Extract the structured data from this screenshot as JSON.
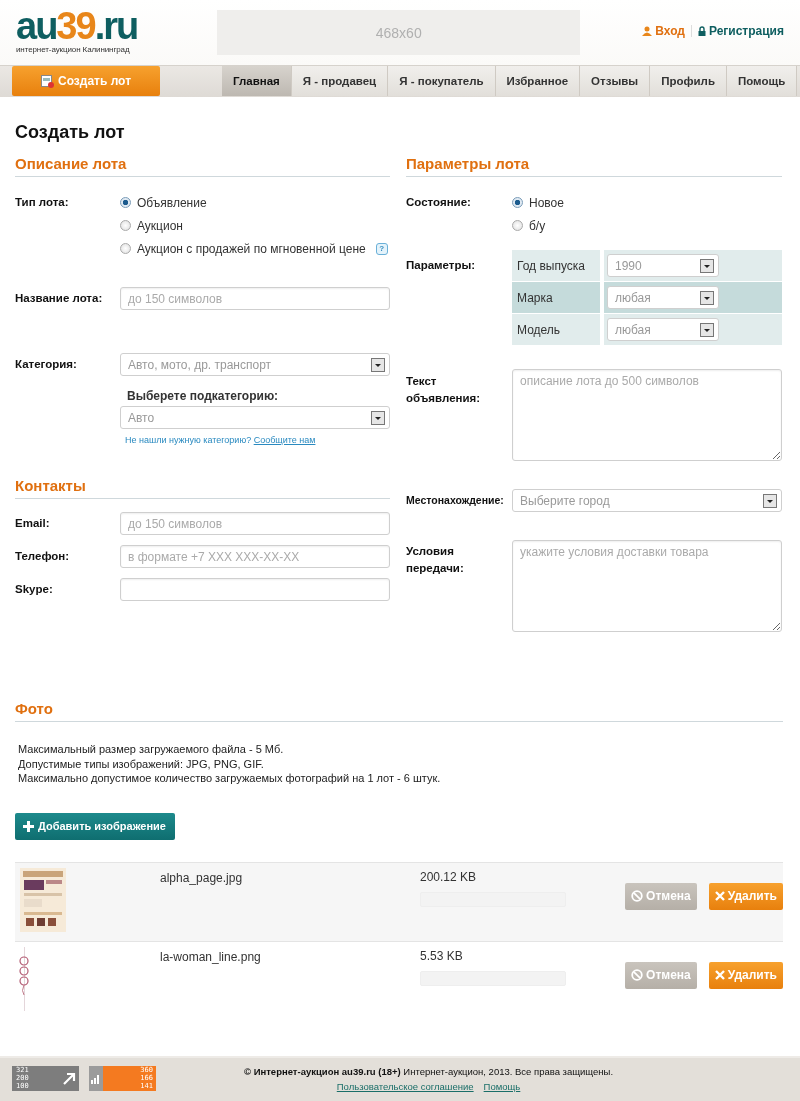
{
  "header": {
    "logo": [
      {
        "text": "au",
        "kind": "base"
      },
      {
        "text": "39",
        "kind": "accent"
      },
      {
        "text": ".ru",
        "kind": "base"
      }
    ],
    "tagline": "интернет-аукцион Калининград",
    "banner": "468x60",
    "login": "Вход",
    "register": "Регистрация"
  },
  "create_button": "Создать лот",
  "nav": [
    {
      "label": "Главная",
      "selected": true
    },
    {
      "label": "Я - продавец",
      "selected": false
    },
    {
      "label": "Я - покупатель",
      "selected": false
    },
    {
      "label": "Избранное",
      "selected": false
    },
    {
      "label": "Отзывы",
      "selected": false
    },
    {
      "label": "Профиль",
      "selected": false
    },
    {
      "label": "Помощь",
      "selected": false
    }
  ],
  "page_title": "Создать лот",
  "description": {
    "title": "Описание лота",
    "type_label": "Тип лота:",
    "type_options": [
      {
        "label": "Объявление",
        "selected": true
      },
      {
        "label": "Аукцион",
        "selected": false
      },
      {
        "label": "Аукцион с продажей по мгновенной цене",
        "selected": false,
        "help": "?"
      }
    ],
    "name_label": "Название лота:",
    "name_placeholder": "до 150 символов",
    "category_label": "Категория:",
    "category_value": "Авто, мото, др. транспорт",
    "subcategory_label": "Выберете подкатегорию:",
    "subcategory_value": "Авто",
    "hint": "Не нашли нужную категорию?",
    "hint_link": "Сообщите нам"
  },
  "contacts": {
    "title": "Контакты",
    "fields": [
      {
        "label": "Email:",
        "placeholder": "до 150 символов"
      },
      {
        "label": "Телефон:",
        "placeholder": "в формате +7 XXX XXX-XX-XX"
      },
      {
        "label": "Skype:"
      }
    ]
  },
  "parameters": {
    "title": "Параметры лота",
    "condition_label": "Состояние:",
    "condition_options": [
      {
        "label": "Новое",
        "selected": true
      },
      {
        "label": "б/у",
        "selected": false
      }
    ],
    "params_label": "Параметры:",
    "params": [
      {
        "name": "Год выпуска",
        "value": "1990",
        "highlighted": false
      },
      {
        "name": "Марка",
        "value": "любая",
        "highlighted": true
      },
      {
        "name": "Модель",
        "value": "любая",
        "highlighted": false
      }
    ],
    "text_label": "Текст объявления:",
    "text_placeholder": "описание лота до 500 символов",
    "location_label": "Местонахождение:",
    "location_placeholder": "Выберите город",
    "terms_label": "Условия передачи:",
    "terms_placeholder": "укажите условия доставки товара"
  },
  "photo": {
    "title": "Фото",
    "info": [
      "Максимальный размер загружаемого файла - 5 Мб.",
      "Допустимые типы изображений: JPG, PNG, GIF.",
      "Максимально допустимое количество загружаемых фотографий на 1 лот - 6 штук."
    ],
    "add_button": "Добавить изображение",
    "files": [
      {
        "kind": "picture",
        "name": "alpha_page.jpg",
        "size": "200.12 KB",
        "level": 0,
        "cancel": "Отмена",
        "delete": "Удалить"
      },
      {
        "kind": "picture",
        "name": "la-woman_line.png",
        "size": "5.53 KB",
        "level": 0,
        "cancel": "Отмена",
        "delete": "Удалить"
      }
    ]
  },
  "footer": {
    "counters": [
      {
        "kind": "grey",
        "values": [
          "321",
          "200",
          "100"
        ]
      },
      {
        "kind": "orange",
        "values": [
          "360",
          "166",
          "141"
        ]
      }
    ],
    "copyright": "**© Интернет-аукцион au39.ru (18+)** Интернет-аукцион, 2013. Все права защищены.",
    "links": [
      "Пользовательское соглашение",
      "Помощь"
    ]
  }
}
